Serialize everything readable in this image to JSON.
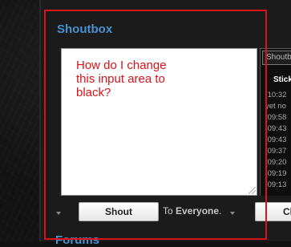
{
  "shoutbox": {
    "title": "Shoutbox",
    "annotation": "How do I change\nthis input area to\nblack?",
    "input_value": "",
    "chat_select": "Shoutb",
    "sticky_label": "Stick",
    "messages": [
      "[10:32",
      "yet no",
      "[09:58",
      "[09:43",
      "[09:43",
      "[09:37",
      "[09:20",
      "[09:19",
      "[09:13"
    ],
    "shout_label": "Shout",
    "to_prefix": "To ",
    "to_target": "Everyone",
    "to_suffix": ".",
    "clear_label": "Cl"
  },
  "forums": {
    "title": "Forums"
  },
  "colors": {
    "title_blue": "#4a90d0",
    "annotation_red": "#d7141a",
    "frame_red": "#d7141a"
  }
}
